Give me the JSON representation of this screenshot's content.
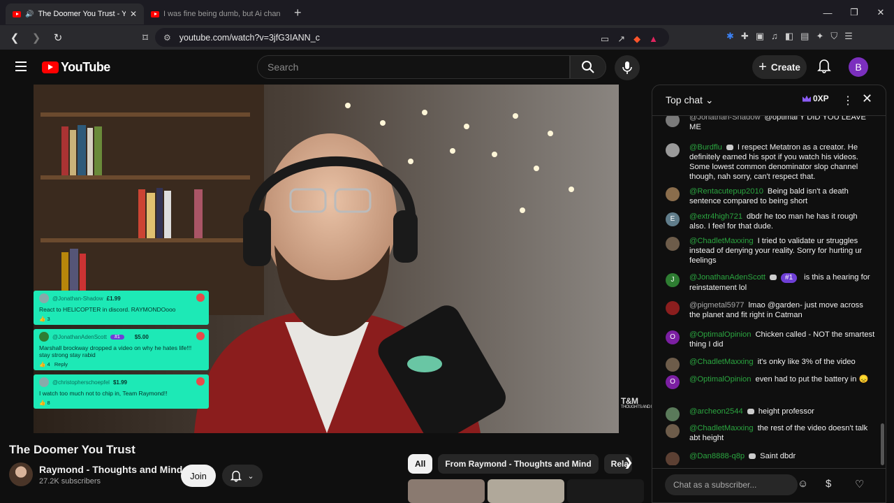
{
  "browser": {
    "tabs": [
      {
        "title": "The Doomer You Trust - YouTube",
        "active": true
      },
      {
        "title": "I was fine being dumb, but Ai changed me",
        "active": false
      }
    ],
    "url": "youtube.com/watch?v=3jfG3IANN_c"
  },
  "header": {
    "logo": "YouTube",
    "search_placeholder": "Search",
    "create_label": "Create",
    "avatar_letter": "B"
  },
  "overlay": {
    "superchats": [
      {
        "user": "@Jonathan-Shadow",
        "amount": "£1.99",
        "message": "React to HELICOPTER in discord. RAYMONDOooo",
        "likes": "3",
        "reply": ""
      },
      {
        "user": "@JonathanAdenScott",
        "rank": "#1",
        "amount": "$5.00",
        "message": "Marshall brockway dropped a video on why he hates life!!! stay strong stay rabid",
        "likes": "4",
        "reply": "Reply"
      },
      {
        "user": "@christopherschoepfel",
        "amount": "$1.99",
        "message": "I watch too much not to chip in, Team Raymond!!",
        "likes": "8",
        "reply": ""
      }
    ],
    "watermark": "T&M",
    "watermark_sub": "THOUGHTS AND MIND"
  },
  "video": {
    "title": "The Doomer You Trust",
    "channel": "Raymond - Thoughts and Mind",
    "subscribers": "27.2K subscribers",
    "join_label": "Join"
  },
  "chips": [
    "All",
    "From Raymond - Thoughts and Mind",
    "Rela"
  ],
  "chat": {
    "title": "Top chat",
    "xp": "0XP",
    "input_placeholder": "Chat as a subscriber...",
    "messages": [
      {
        "user": "@Jonathan-Shadow",
        "text": "@optimal Y DID YOU LEAVE ME",
        "avatar": "",
        "color": "#7a7a7a",
        "member": false
      },
      {
        "user": "@Burdflu",
        "text": "I respect Metatron as a creator. He definitely earned his spot if you watch his videos. Some lowest common denominator slop channel though, nah sorry, can't respect that.",
        "avatar": "",
        "color": "#9a9a9a",
        "member": true
      },
      {
        "user": "@Rentacutepup2010",
        "text": "Being bald isn't a death sentence compared to being short",
        "avatar": "",
        "color": "#8a6d4c",
        "member": false
      },
      {
        "user": "@extr4high721",
        "text": "dbdr he too man he has it rough also. I feel for that dude.",
        "avatar": "E",
        "color": "#607d8b",
        "member": false
      },
      {
        "user": "@ChadletMaxxing",
        "text": "I tried to validate ur struggles instead of denying your reality. Sorry for hurting ur feelings",
        "avatar": "",
        "color": "#6d5c4a",
        "member": false
      },
      {
        "user": "@JonathanAdenScott",
        "rank": "#1",
        "text": "is this a hearing for reinstatement lol",
        "avatar": "J",
        "color": "#2e7d32",
        "member": true
      },
      {
        "user": "@pigmetal5977",
        "text": "lmao @garden- just move across the planet and fit right in Catman",
        "avatar": "",
        "color": "#8b1e1e",
        "member": false
      },
      {
        "user": "@OptimalOpinion",
        "text": "Chicken called - NOT the smartest thing I did",
        "avatar": "O",
        "color": "#7b1fa2",
        "member": false
      },
      {
        "user": "@ChadletMaxxing",
        "text": "it's onky like 3% of the video",
        "avatar": "",
        "color": "#6d5c4a",
        "member": false
      },
      {
        "user": "@OptimalOpinion",
        "text": "even had to put the battery in",
        "avatar": "O",
        "color": "#7b1fa2",
        "member": false
      },
      {
        "user": "@archeon2544",
        "text": "height professor",
        "avatar": "",
        "color": "#5a7a5a",
        "member": true
      },
      {
        "user": "@ChadletMaxxing",
        "text": "the rest of the video doesn't talk abt height",
        "avatar": "",
        "color": "#6d5c4a",
        "member": false
      },
      {
        "user": "@Dan8888-q8p",
        "text": "Saint dbdr",
        "avatar": "",
        "color": "#5c4033",
        "member": true
      }
    ]
  }
}
